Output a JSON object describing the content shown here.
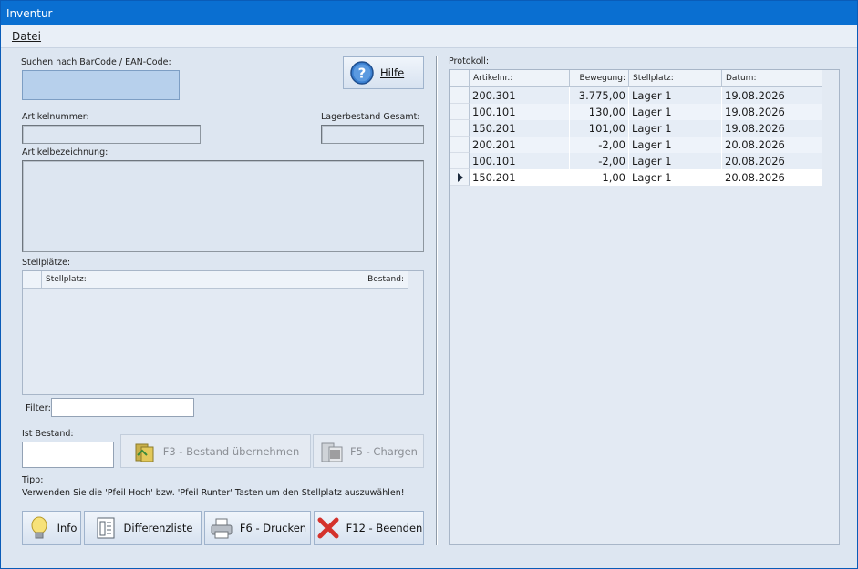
{
  "window": {
    "title": "Inventur"
  },
  "menu": {
    "file": "Datei"
  },
  "search": {
    "label": "Suchen nach BarCode / EAN-Code:"
  },
  "help_button": {
    "label": "Hilfe"
  },
  "article_number": {
    "label": "Artikelnummer:"
  },
  "stock_total": {
    "label": "Lagerbestand Gesamt:"
  },
  "article_desc": {
    "label": "Artikelbezeichnung:"
  },
  "storage": {
    "label": "Stellplätze:",
    "columns": [
      "Stellplatz:",
      "Bestand:"
    ]
  },
  "filter": {
    "label": "Filter:"
  },
  "actual_stock": {
    "label": "Ist Bestand:"
  },
  "buttons": {
    "apply_stock": "F3 - Bestand übernehmen",
    "batches": "F5 - Chargen",
    "info": "Info",
    "diff_list": "Differenzliste",
    "print": "F6 - Drucken",
    "exit": "F12 - Beenden"
  },
  "tip": {
    "title": "Tipp:",
    "text": "Verwenden Sie die 'Pfeil Hoch' bzw. 'Pfeil Runter' Tasten um den Stellplatz auszuwählen!"
  },
  "protocol": {
    "label": "Protokoll:",
    "columns": [
      "Artikelnr.:",
      "Bewegung:",
      "Stellplatz:",
      "Datum:"
    ],
    "rows": [
      [
        "200.301",
        "3.775,00",
        "Lager 1",
        "19.08.2026"
      ],
      [
        "100.101",
        "130,00",
        "Lager 1",
        "19.08.2026"
      ],
      [
        "150.201",
        "101,00",
        "Lager 1",
        "19.08.2026"
      ],
      [
        "200.201",
        "-2,00",
        "Lager 1",
        "20.08.2026"
      ],
      [
        "100.101",
        "-2,00",
        "Lager 1",
        "20.08.2026"
      ],
      [
        "150.201",
        "1,00",
        "Lager 1",
        "20.08.2026"
      ]
    ],
    "selected_row": 5
  }
}
